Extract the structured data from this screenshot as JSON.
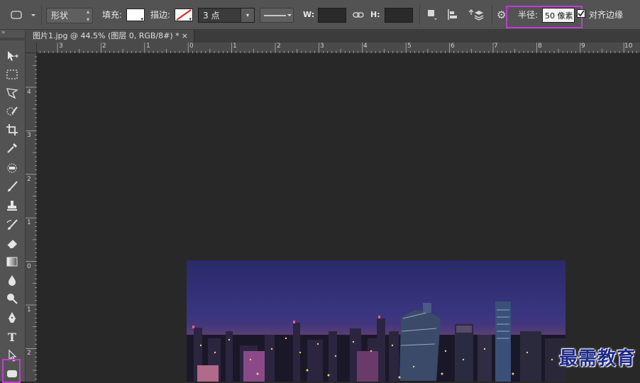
{
  "options_bar": {
    "shape_mode": "形状",
    "fill_label": "填充:",
    "stroke_label": "描边:",
    "stroke_width": "3 点",
    "w_label": "W:",
    "h_label": "H:",
    "radius_label": "半径:",
    "radius_value": "50 像素",
    "align_edges_label": "对齐边缘"
  },
  "document": {
    "tab_title": "图片1.jpg @ 44.5% (图层 0, RGB/8#) *",
    "close_symbol": "×"
  },
  "rulers": {
    "top_labels": [
      "3",
      "2",
      "1",
      "0",
      "1",
      "2",
      "3",
      "4",
      "5",
      "6",
      "7",
      "8",
      "9",
      "10"
    ],
    "left_labels": [
      "4",
      "3",
      "2",
      "1",
      "0",
      "1",
      "2"
    ]
  },
  "watermark": "最需教育",
  "colors": {
    "highlight": "#c23cd4",
    "panel_bg": "#535353",
    "workspace_bg": "#282828"
  }
}
